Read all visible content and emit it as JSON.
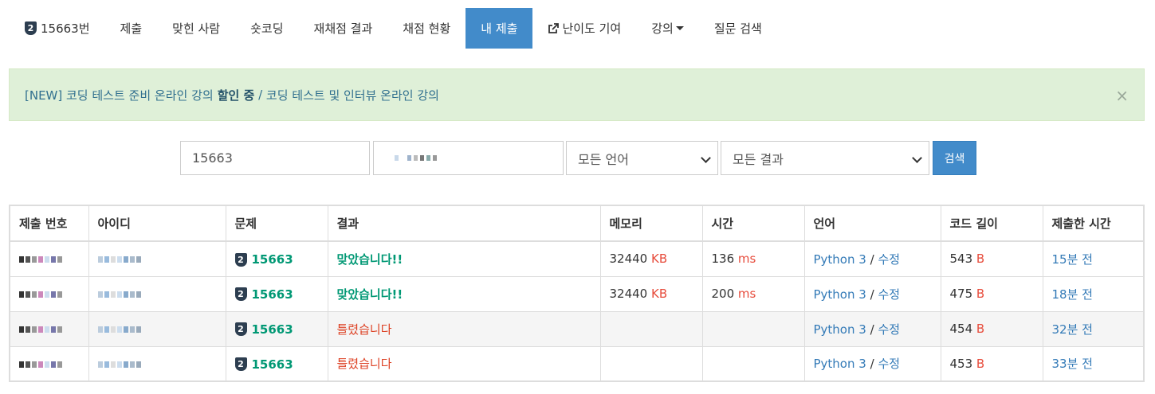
{
  "nav": {
    "problem": {
      "tier_num": "2",
      "label": "15663번"
    },
    "items": [
      {
        "label": "제출"
      },
      {
        "label": "맞힌 사람"
      },
      {
        "label": "숏코딩"
      },
      {
        "label": "재채점 결과"
      },
      {
        "label": "채점 현황"
      },
      {
        "label": "내 제출",
        "active": true
      },
      {
        "label": "난이도 기여",
        "icon": "external-link-icon"
      },
      {
        "label": "강의",
        "icon": "caret-down-icon"
      },
      {
        "label": "질문 검색"
      }
    ]
  },
  "alert": {
    "prefix": "[NEW] 코딩 테스트 준비 온라인 강의 ",
    "bold": "할인 중",
    "separator": " / ",
    "link": "코딩 테스트 및 인터뷰 온라인 강의",
    "close": "×"
  },
  "search": {
    "problem_value": "15663",
    "language_selected": "모든 언어",
    "result_selected": "모든 결과",
    "button": "검색"
  },
  "table": {
    "headers": [
      "제출 번호",
      "아이디",
      "문제",
      "결과",
      "메모리",
      "시간",
      "언어",
      "코드 길이",
      "제출한 시간"
    ],
    "memory_unit": "KB",
    "time_unit": "ms",
    "length_unit": "B",
    "rows": [
      {
        "problem": "15663",
        "tier": "2",
        "result": "맞았습니다!!",
        "status": "ac",
        "memory": "32440",
        "time": "136",
        "language": "Python 3",
        "edit": "수정",
        "length": "543",
        "submitted": "15분 전"
      },
      {
        "problem": "15663",
        "tier": "2",
        "result": "맞았습니다!!",
        "status": "ac",
        "memory": "32440",
        "time": "200",
        "language": "Python 3",
        "edit": "수정",
        "length": "475",
        "submitted": "18분 전"
      },
      {
        "problem": "15663",
        "tier": "2",
        "result": "틀렸습니다",
        "status": "wa",
        "memory": "",
        "time": "",
        "language": "Python 3",
        "edit": "수정",
        "length": "454",
        "submitted": "32분 전"
      },
      {
        "problem": "15663",
        "tier": "2",
        "result": "틀렸습니다",
        "status": "wa",
        "memory": "",
        "time": "",
        "language": "Python 3",
        "edit": "수정",
        "length": "453",
        "submitted": "33분 전"
      }
    ]
  },
  "colors": {
    "accent": "#428bca",
    "accepted": "#009874",
    "wrong": "#dd4124",
    "link": "#337ab7"
  }
}
